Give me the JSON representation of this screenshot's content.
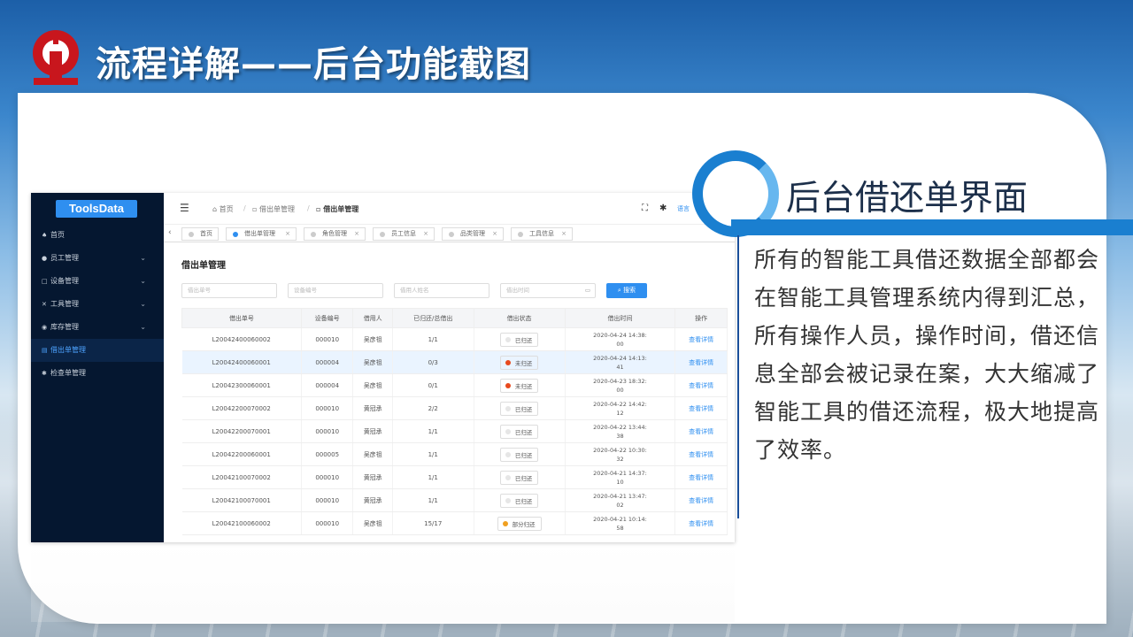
{
  "slide": {
    "title": "流程详解——后台功能截图",
    "subtitle": "后台借还单界面",
    "description": "所有的智能工具借还数据全部都会在智能工具管理系统内得到汇总，所有操作人员，操作时间，借还信息全部会被记录在案，大大缩减了智能工具的借还流程，极大地提高了效率。"
  },
  "app": {
    "logo": "ToolsData",
    "sidebar": [
      {
        "label": "首页",
        "icon": "home-icon",
        "chevron": false,
        "active": false
      },
      {
        "label": "员工管理",
        "icon": "users-icon",
        "chevron": true,
        "active": false
      },
      {
        "label": "设备管理",
        "icon": "device-icon",
        "chevron": true,
        "active": false
      },
      {
        "label": "工具管理",
        "icon": "tool-icon",
        "chevron": true,
        "active": false
      },
      {
        "label": "库存管理",
        "icon": "stock-icon",
        "chevron": true,
        "active": false
      },
      {
        "label": "借出单管理",
        "icon": "doc-icon",
        "chevron": false,
        "active": true
      },
      {
        "label": "检查单管理",
        "icon": "check-icon",
        "chevron": false,
        "active": false
      }
    ],
    "breadcrumb": [
      "首页",
      "借出单管理",
      "借出单管理"
    ],
    "language": "语言",
    "tabs": [
      "首页",
      "借出单管理",
      "角色管理",
      "员工信息",
      "品类管理",
      "工具信息"
    ],
    "page_title": "借出单管理",
    "filters": {
      "order_no": "借出单号",
      "device_no": "设备编号",
      "borrower": "借用人姓名",
      "time": "借出时间",
      "search": "搜索"
    },
    "table": {
      "headers": [
        "借出单号",
        "设备编号",
        "借用人",
        "已归还/总借出",
        "借出状态",
        "借出时间",
        "操作"
      ],
      "rows": [
        {
          "no": "L20042400060002",
          "dev": "000010",
          "user": "吴彦祖",
          "ratio": "1/1",
          "status": "已归还",
          "status_color": "#e6e6e6",
          "time1": "2020-04-24 14:38:",
          "time2": "00",
          "op": "查看详情"
        },
        {
          "no": "L20042400060001",
          "dev": "000004",
          "user": "吴彦祖",
          "ratio": "0/3",
          "status": "未归还",
          "status_color": "#e8491d",
          "time1": "2020-04-24 14:13:",
          "time2": "41",
          "op": "查看详情"
        },
        {
          "no": "L20042300060001",
          "dev": "000004",
          "user": "吴彦祖",
          "ratio": "0/1",
          "status": "未归还",
          "status_color": "#e8491d",
          "time1": "2020-04-23 18:32:",
          "time2": "00",
          "op": "查看详情"
        },
        {
          "no": "L20042200070002",
          "dev": "000010",
          "user": "黄冠承",
          "ratio": "2/2",
          "status": "已归还",
          "status_color": "#e6e6e6",
          "time1": "2020-04-22 14:42:",
          "time2": "12",
          "op": "查看详情"
        },
        {
          "no": "L20042200070001",
          "dev": "000010",
          "user": "黄冠承",
          "ratio": "1/1",
          "status": "已归还",
          "status_color": "#e6e6e6",
          "time1": "2020-04-22 13:44:",
          "time2": "38",
          "op": "查看详情"
        },
        {
          "no": "L20042200060001",
          "dev": "000005",
          "user": "吴彦祖",
          "ratio": "1/1",
          "status": "已归还",
          "status_color": "#e6e6e6",
          "time1": "2020-04-22 10:30:",
          "time2": "32",
          "op": "查看详情"
        },
        {
          "no": "L20042100070002",
          "dev": "000010",
          "user": "黄冠承",
          "ratio": "1/1",
          "status": "已归还",
          "status_color": "#e6e6e6",
          "time1": "2020-04-21 14:37:",
          "time2": "10",
          "op": "查看详情"
        },
        {
          "no": "L20042100070001",
          "dev": "000010",
          "user": "黄冠承",
          "ratio": "1/1",
          "status": "已归还",
          "status_color": "#e6e6e6",
          "time1": "2020-04-21 13:47:",
          "time2": "02",
          "op": "查看详情"
        },
        {
          "no": "L20042100060002",
          "dev": "000010",
          "user": "吴彦祖",
          "ratio": "15/17",
          "status": "部分归还",
          "status_color": "#f0a020",
          "time1": "2020-04-21 10:14:",
          "time2": "58",
          "op": "查看详情"
        }
      ]
    }
  }
}
